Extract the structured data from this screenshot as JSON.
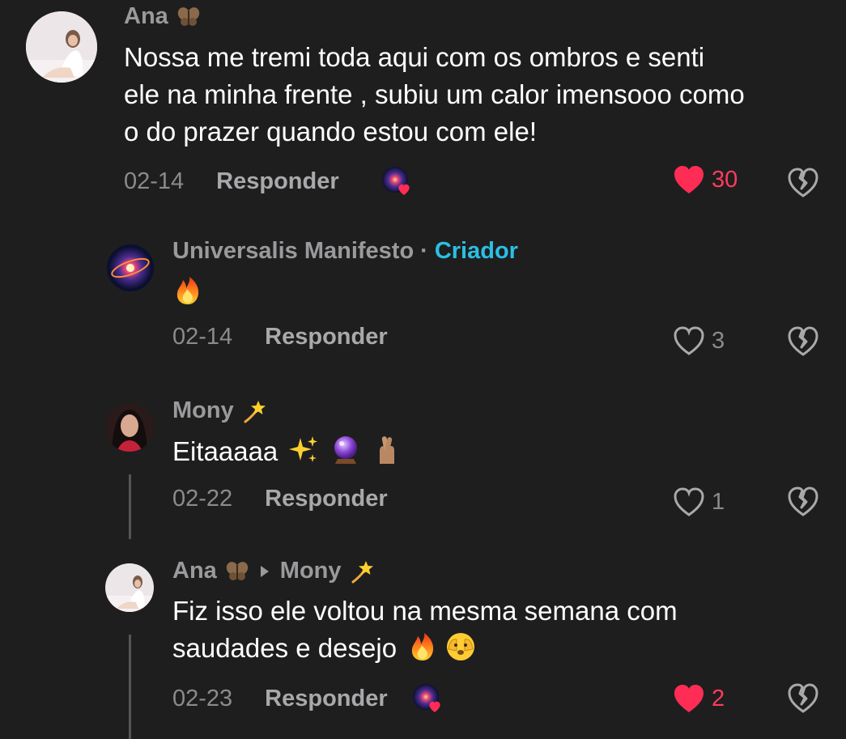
{
  "comments": [
    {
      "username": "Ana",
      "badge_icon": "butterfly-icon",
      "text_lines": [
        "Nossa me tremi toda aqui com os ombros e senti",
        "ele na minha frente , subiu um calor imensooo como",
        "o do prazer quando estou com ele!"
      ],
      "date": "02-14",
      "reply_label": "Responder",
      "likes": "30",
      "liked": true
    },
    {
      "username": "Universalis Manifesto",
      "separator": "·",
      "creator_label": "Criador",
      "text_icon": "fire-icon",
      "date": "02-14",
      "reply_label": "Responder",
      "likes": "3",
      "liked": false
    },
    {
      "username": "Mony",
      "badge_icon": "dizzy-star-icon",
      "text": "Eitaaaaa",
      "text_icons": [
        "sparkles-icon",
        "crystal-ball-icon",
        "crossed-fingers-icon"
      ],
      "date": "02-22",
      "reply_label": "Responder",
      "likes": "1",
      "liked": false
    },
    {
      "username": "Ana",
      "badge_icon": "butterfly-icon",
      "reply_to": "Mony",
      "reply_to_badge_icon": "dizzy-star-icon",
      "text_lines": [
        "Fiz isso ele voltou na mesma semana com",
        "saudades e desejo"
      ],
      "text_icons": [
        "fire-icon",
        "peeking-face-icon"
      ],
      "date": "02-23",
      "reply_label": "Responder",
      "likes": "2",
      "liked": true
    }
  ],
  "colors": {
    "background": "#1e1e1f",
    "username": "#9a9a9c",
    "creator": "#2bbfe3",
    "like_active": "#ff3b5c",
    "text": "#ffffff"
  }
}
